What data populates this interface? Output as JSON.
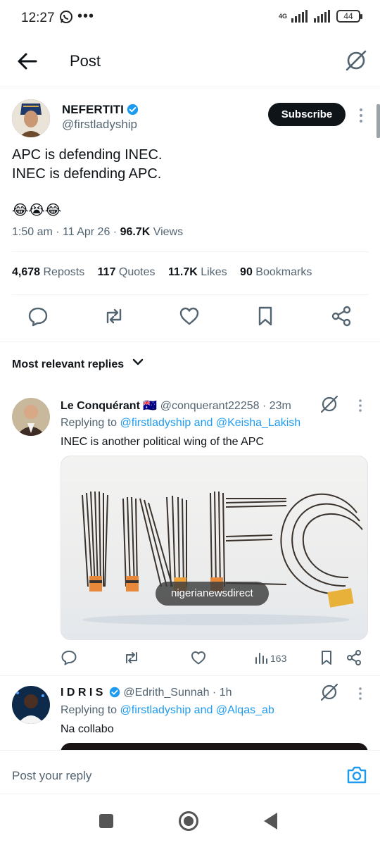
{
  "status_bar": {
    "time": "12:27",
    "network": "4G",
    "battery": "44"
  },
  "header": {
    "title": "Post"
  },
  "post": {
    "author_name": "NEFERTITI",
    "author_handle": "@firstladyship",
    "subscribe_label": "Subscribe",
    "text_line1": "APC is defending INEC.",
    "text_line2": "INEC is defending APC.",
    "emoji": "😂😭😂",
    "time": "1:50 am",
    "date": "11 Apr 26",
    "views_count": "96.7K",
    "views_label": "Views",
    "stats": {
      "reposts_count": "4,678",
      "reposts_label": "Reposts",
      "quotes_count": "117",
      "quotes_label": "Quotes",
      "likes_count": "11.7K",
      "likes_label": "Likes",
      "bookmarks_count": "90",
      "bookmarks_label": "Bookmarks"
    }
  },
  "replies_sort": {
    "label": "Most relevant replies"
  },
  "replies": [
    {
      "name": "Le Conquérant",
      "flag": "🇦🇺",
      "handle": "@conquerant22258",
      "age": "23m",
      "replying_prefix": "Replying to",
      "replying_user1": "@firstladyship",
      "replying_and": "and",
      "replying_user2": "@Keisha_Lakish",
      "text": "INEC is another political wing of the APC",
      "media_tag": "nigerianewsdirect",
      "views": "163"
    },
    {
      "name": "I D R I S",
      "handle": "@Edrith_Sunnah",
      "age": "1h",
      "replying_prefix": "Replying to",
      "replying_user1": "@firstladyship",
      "replying_and": "and",
      "replying_user2": "@Alqas_ab",
      "text": "Na collabo"
    }
  ],
  "composer": {
    "placeholder": "Post your reply"
  },
  "colors": {
    "accent": "#1d9bf0",
    "text": "#0f1419",
    "muted": "#536471",
    "divider": "#eff3f4"
  }
}
